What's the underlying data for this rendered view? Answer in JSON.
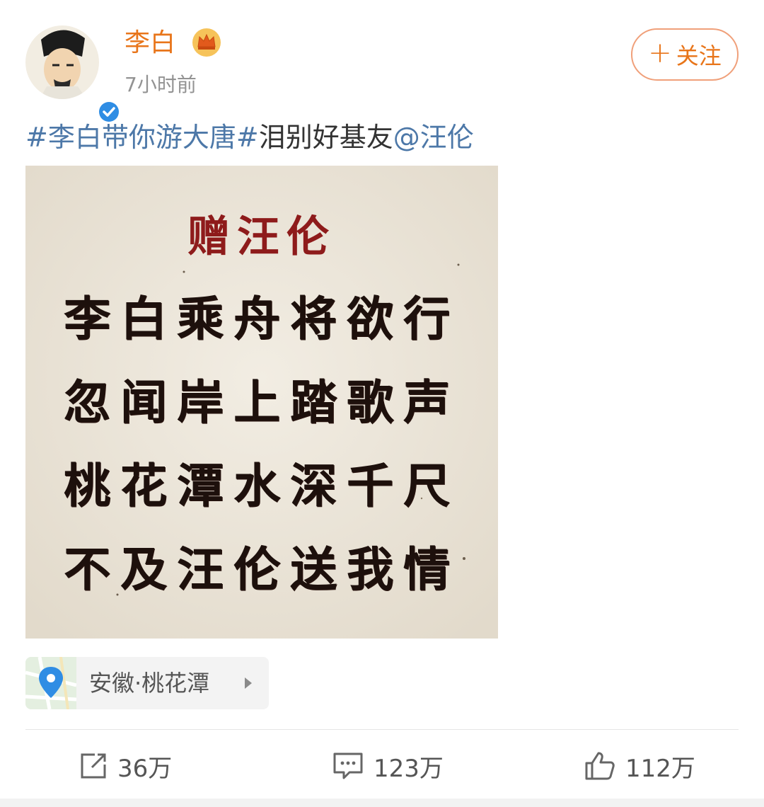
{
  "user": {
    "name": "李白",
    "time": "7小时前",
    "follow_label": "关注"
  },
  "post": {
    "hashtag": "#李白带你游大唐#",
    "text": "泪别好基友",
    "mention": "@汪伦"
  },
  "poem": {
    "title": "赠汪伦",
    "lines": [
      "李白乘舟将欲行",
      "忽闻岸上踏歌声",
      "桃花潭水深千尺",
      "不及汪伦送我情"
    ]
  },
  "location": {
    "label": "安徽·桃花潭"
  },
  "actions": {
    "repost_count": "36万",
    "comment_count": "123万",
    "like_count": "112万"
  },
  "colors": {
    "username": "#e8751a",
    "link": "#4d78a8",
    "poem_title": "#8e1b1b",
    "poem_text": "#1d100c"
  },
  "icons": [
    "verified-icon",
    "crown-icon",
    "plus-icon",
    "location-pin-icon",
    "chevron-right-icon",
    "repost-icon",
    "comment-icon",
    "like-icon"
  ]
}
